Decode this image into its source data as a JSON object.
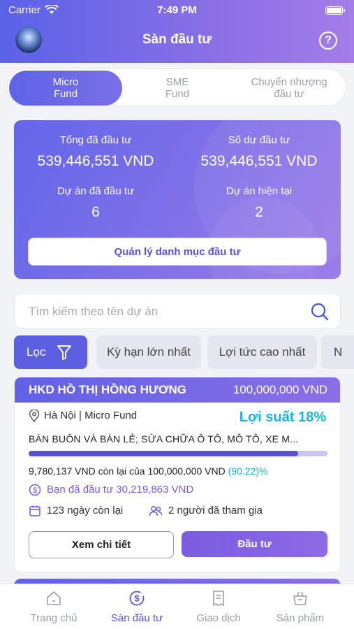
{
  "status_bar": {
    "carrier": "Carrier",
    "time": "7:49 PM"
  },
  "header": {
    "title": "Sàn đầu tư",
    "help_glyph": "?"
  },
  "tabs": [
    {
      "label": "Micro\nFund",
      "active": true
    },
    {
      "label": "SME\nFund",
      "active": false
    },
    {
      "label": "Chuyển nhượng\nđầu tư",
      "active": false
    }
  ],
  "summary": {
    "total_invested_label": "Tổng đã đầu tư",
    "total_invested_value": "539,446,551 VND",
    "balance_label": "Số dư đầu tư",
    "balance_value": "539,446,551 VND",
    "projects_invested_label": "Dự án đã đầu tư",
    "projects_invested_value": "6",
    "current_projects_label": "Dự án hiện tại",
    "current_projects_value": "2",
    "manage_button": "Quản lý danh mục đầu tư"
  },
  "search": {
    "placeholder": "Tìm kiếm theo tên dự án",
    "icon": "search-icon"
  },
  "filters": {
    "filter_label": "Lọc",
    "chips": [
      "Kỳ hạn lớn nhất",
      "Lợi tức cao nhất",
      "N"
    ]
  },
  "project": {
    "name": "HKD HỒ THỊ HỒNG HƯƠNG",
    "amount": "100,000,000 VND",
    "location": "Hà Nội | Micro Fund",
    "rate": "Lợi suất 18%",
    "category": "BÁN BUÔN VÀ BÁN LẺ; SỬA CHỮA Ô TÔ, MÔ TÔ, XE M...",
    "progress_fraction": 0.9022,
    "remaining_text": "9,780,137 VND còn lại của 100,000,000 VND ",
    "remaining_pct": "(90.22)%",
    "invested_text": "Bạn đã đầu tư 30,219,863 VND",
    "days_left": "123 ngày còn lại",
    "participants": "2 người đã tham gia",
    "detail_button": "Xem chi tiết",
    "invest_button": "Đầu tư"
  },
  "tabbar": [
    {
      "label": "Trang chủ",
      "icon": "home-icon",
      "active": false
    },
    {
      "label": "Sàn đầu tư",
      "icon": "dollar-exchange-icon",
      "active": true
    },
    {
      "label": "Giao dịch",
      "icon": "receipt-icon",
      "active": false
    },
    {
      "label": "Sản phẩm",
      "icon": "basket-icon",
      "active": false
    }
  ],
  "colors": {
    "accent": "#5b5fe0",
    "rate": "#18b5d8",
    "invested": "#7b58d8"
  }
}
